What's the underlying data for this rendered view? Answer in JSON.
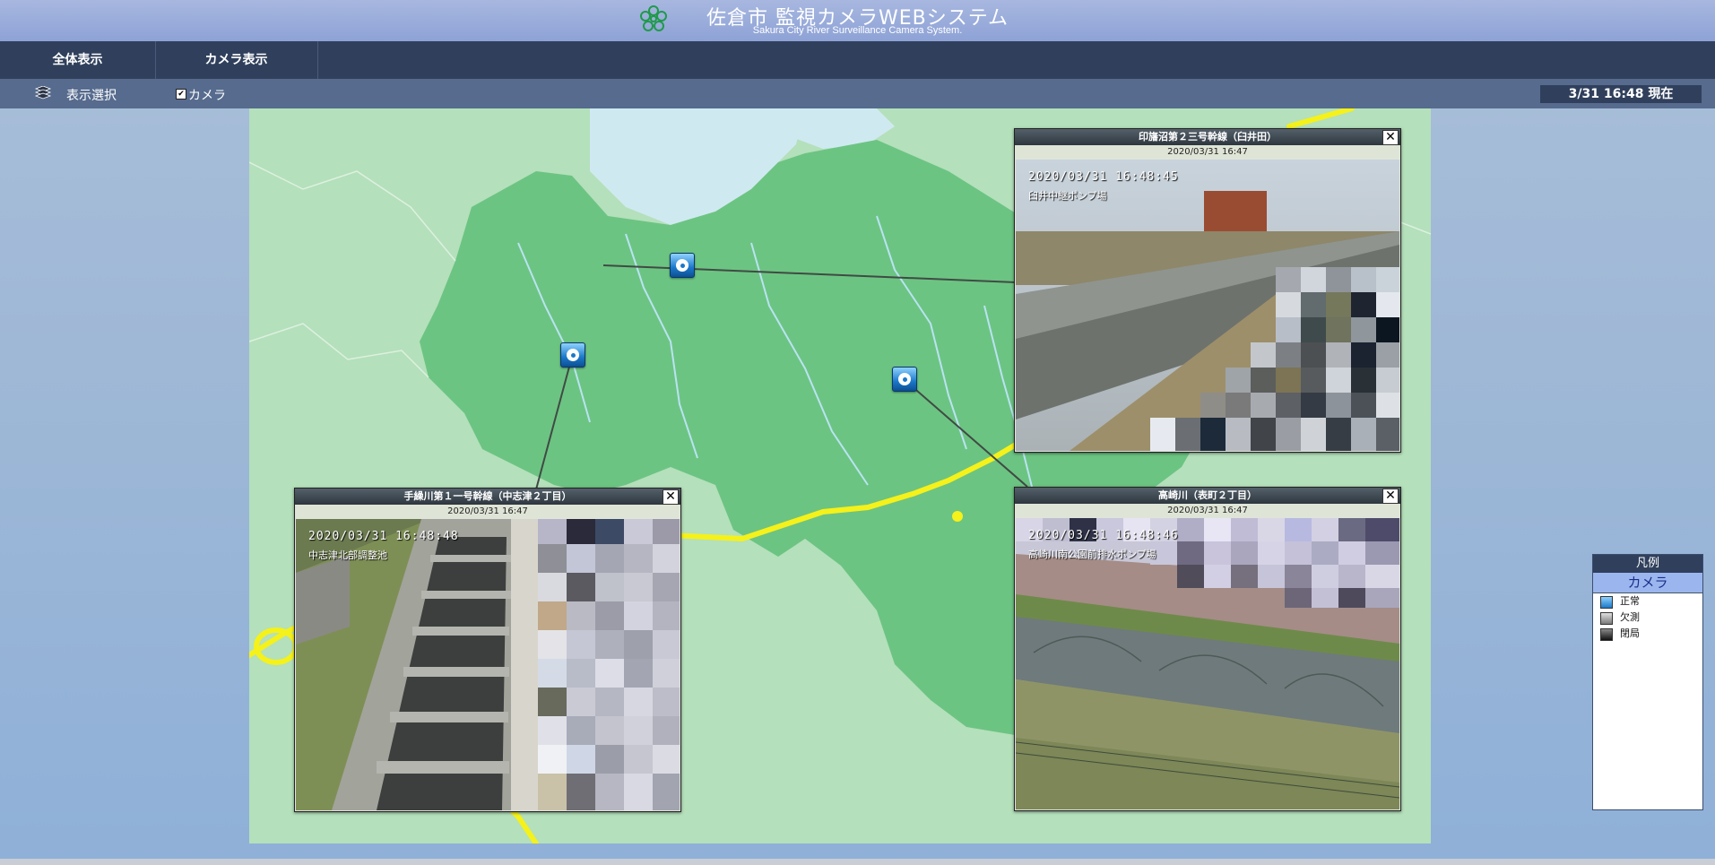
{
  "header": {
    "title": "佐倉市 監視カメラWEBシステム",
    "subtitle": "Sakura City River Surveillance Camera System."
  },
  "nav": {
    "tabs": [
      {
        "label": "全体表示"
      },
      {
        "label": "カメラ表示"
      }
    ]
  },
  "toolbar": {
    "display_select_label": "表示選択",
    "camera_checkbox_label": "カメラ",
    "camera_checked": true,
    "current_time": "3/31 16:48 現在"
  },
  "popups": [
    {
      "title": "印旛沼第２三号幹線（臼井田）",
      "date": "2020/03/31 16:47",
      "timestamp": "2020/03/31 16:48:45",
      "location": "臼井中継ポンプ場"
    },
    {
      "title": "手繰川第１一号幹線（中志津２丁目）",
      "date": "2020/03/31 16:47",
      "timestamp": "2020/03/31 16:48:48",
      "location": "中志津北部調整池"
    },
    {
      "title": "高崎川（表町２丁目）",
      "date": "2020/03/31 16:47",
      "timestamp": "2020/03/31 16:48:46",
      "location": "高崎川南公園前排水ポンプ場"
    }
  ],
  "legend": {
    "title": "凡例",
    "category": "カメラ",
    "items": [
      {
        "label": "正常"
      },
      {
        "label": "欠測"
      },
      {
        "label": "閉局"
      }
    ]
  },
  "colors": {
    "nav": "#30405c",
    "map_land": "#6cc482",
    "map_bg": "#b4e0bb",
    "road": "#f5f11a"
  }
}
